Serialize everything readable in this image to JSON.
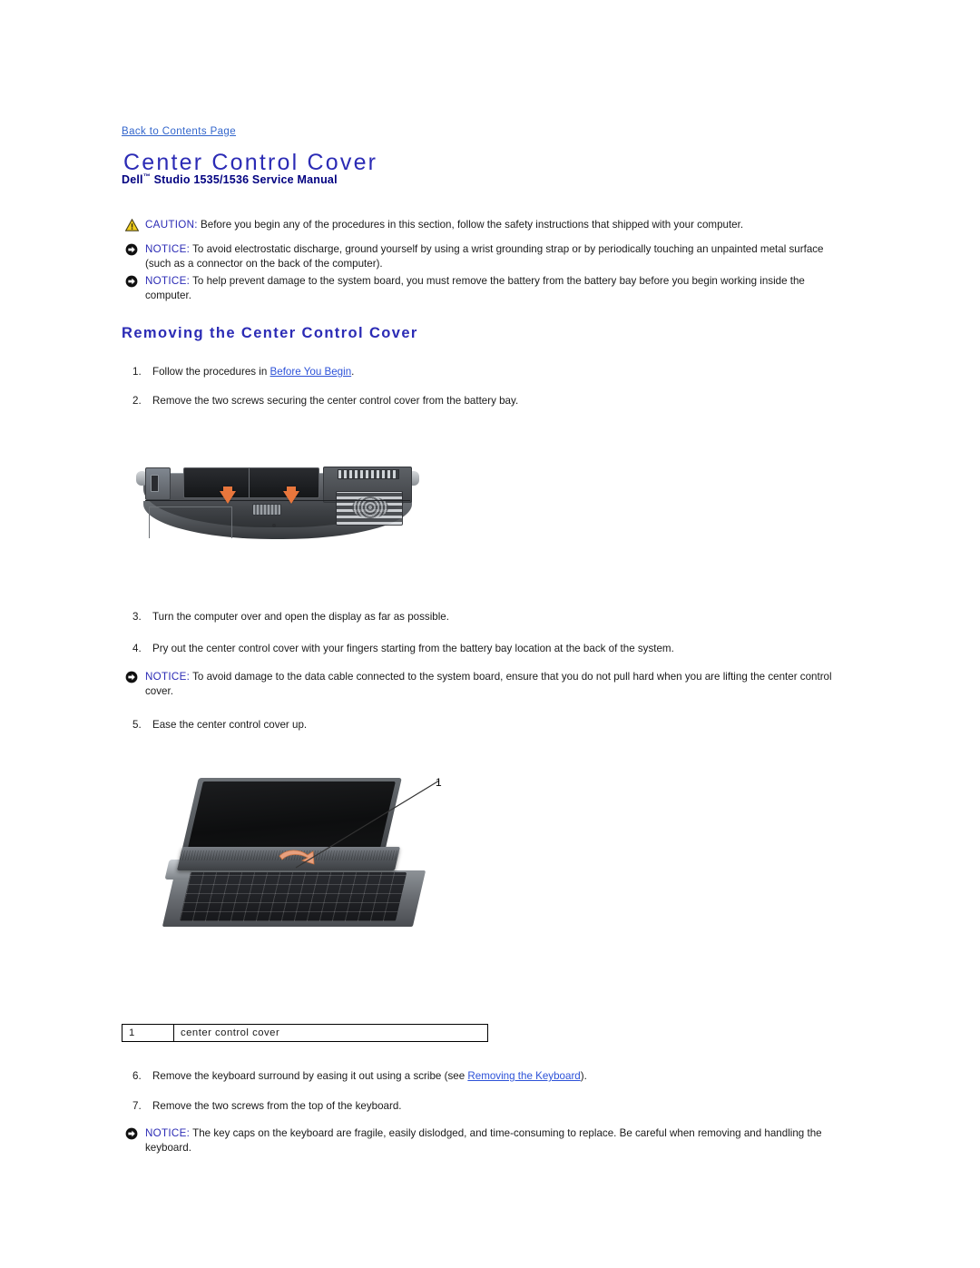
{
  "page": {
    "back_link": "Back to Contents Page",
    "title": "Center Control Cover",
    "subtitle_pre": "Dell",
    "subtitle_tm": "™",
    "subtitle_post": " Studio 1535/1536 Service Manual",
    "colors": {
      "title_blue": "#2b2bb5",
      "subtitle_navy": "#000080",
      "link_blue": "#2d52d8",
      "back_link_blue": "#3366cc",
      "caution_yellow": "#f2cf1b",
      "text_black": "#1a1a1a",
      "arrow_orange": "#e8763c"
    }
  },
  "admonitions": [
    {
      "icon": "caution-triangle-icon",
      "keyword": "CAUTION:",
      "text": " Before you begin any of the procedures in this section, follow the safety instructions that shipped with your computer."
    },
    {
      "icon": "notice-circle-arrow-icon",
      "keyword": "NOTICE:",
      "text": " To avoid electrostatic discharge, ground yourself by using a wrist grounding strap or by periodically touching an unpainted metal surface (such as a connector on the back of the computer)."
    },
    {
      "icon": "notice-circle-arrow-icon",
      "keyword": "NOTICE:",
      "text": " To help prevent damage to the system board, you must remove the battery from the battery bay before you begin working inside the computer."
    }
  ],
  "section": {
    "heading": "Removing the Center Control Cover"
  },
  "steps": [
    {
      "num": "1.",
      "text_before": "Follow the procedures in ",
      "link": "Before You Begin",
      "text_after": "."
    },
    {
      "num": "2.",
      "text_before": "Remove the two screws securing the center control cover from the battery bay.",
      "link": "",
      "text_after": ""
    },
    {
      "num": "3.",
      "text_before": "Turn the computer over and open the display as far as possible.",
      "link": "",
      "text_after": ""
    },
    {
      "num": "4.",
      "text_before": "Pry out the center control cover with your fingers starting from the battery bay location at the back of the system.",
      "link": "",
      "text_after": ""
    },
    {
      "num": "5.",
      "text_before": "Ease the center control cover up.",
      "link": "",
      "text_after": ""
    },
    {
      "num": "6.",
      "text_before": "Remove the keyboard surround by easing it out using a scribe (see ",
      "link": "Removing the Keyboard",
      "text_after": ")."
    },
    {
      "num": "7.",
      "text_before": "Remove the two screws from the top of the keyboard.",
      "link": "",
      "text_after": ""
    }
  ],
  "mid_notice": {
    "icon": "notice-circle-arrow-icon",
    "keyword": "NOTICE:",
    "text": " To avoid damage to the data cable connected to the system board, ensure that you do not pull hard when you are lifting the center control cover."
  },
  "bottom_notice": {
    "icon": "notice-circle-arrow-icon",
    "keyword": "NOTICE:",
    "text": " The key caps on the keyboard are fragile, easily dislodged, and time-consuming to replace. Be careful when removing and handling the keyboard."
  },
  "figures": {
    "figure1": {
      "name": "laptop-bottom-battery-bay-photo",
      "description": "Bottom view of laptop showing battery bay with two screws and vent grille"
    },
    "figure2": {
      "name": "center-control-cover-removal-photo",
      "description": "Open laptop with center control cover being lifted above keyboard",
      "callout": "1"
    }
  },
  "legend": {
    "rows": [
      {
        "num": "1",
        "label": "center control cover"
      }
    ]
  }
}
